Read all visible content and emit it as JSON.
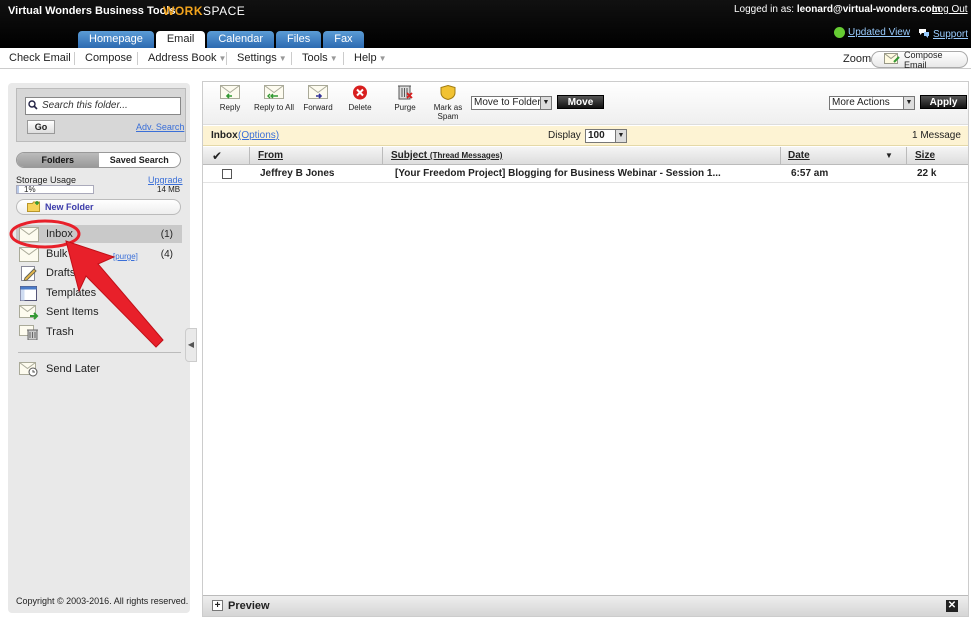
{
  "app": {
    "brand": "Virtual Wonders Business Tools",
    "workspace_logo": {
      "part1": "WORK",
      "part2": "SPACE"
    },
    "logged_in_prefix": "Logged in as:",
    "logged_in_user": "leonard@virtual-wonders.com",
    "logout": "Log Out",
    "updated_view": "Updated View",
    "support": "Support"
  },
  "tabs": [
    {
      "label": "Homepage",
      "active": false
    },
    {
      "label": "Email",
      "active": true
    },
    {
      "label": "Calendar",
      "active": false
    },
    {
      "label": "Files",
      "active": false
    },
    {
      "label": "Fax",
      "active": false
    }
  ],
  "menu": {
    "check_email": "Check Email",
    "compose": "Compose",
    "address_book": "Address Book",
    "settings": "Settings",
    "tools": "Tools",
    "help": "Help",
    "zoom": "Zoom",
    "compose_email": "Compose Email"
  },
  "sidebar": {
    "search_placeholder": "Search this folder...",
    "go": "Go",
    "adv_search": "Adv. Search",
    "tab_folders": "Folders",
    "tab_saved_search": "Saved Search",
    "storage_label": "Storage Usage",
    "upgrade": "Upgrade",
    "storage_percent": "1%",
    "storage_used_fraction": 0.01,
    "storage_size": "14 MB",
    "new_folder": "New Folder",
    "folders": [
      {
        "name": "Inbox",
        "count": "(1)",
        "icon": "envelope-icon"
      },
      {
        "name": "Bulk Mail",
        "count": "(4)",
        "icon": "envelope-icon",
        "purge": "[purge]"
      },
      {
        "name": "Drafts",
        "count": "",
        "icon": "pencil-icon"
      },
      {
        "name": "Templates",
        "count": "",
        "icon": "template-icon"
      },
      {
        "name": "Sent Items",
        "count": "",
        "icon": "envelope-arrow-icon"
      },
      {
        "name": "Trash",
        "count": "",
        "icon": "trash-icon"
      }
    ],
    "send_later": "Send Later",
    "copyright": "Copyright © 2003-2016. All rights reserved."
  },
  "toolbar": {
    "reply": "Reply",
    "reply_all": "Reply to All",
    "forward": "Forward",
    "delete": "Delete",
    "purge": "Purge",
    "mark_spam_line1": "Mark as",
    "mark_spam_line2": "Spam",
    "move_to_folder": "Move to Folder",
    "move": "Move",
    "more_actions": "More Actions",
    "apply": "Apply"
  },
  "infobar": {
    "folder": "Inbox",
    "options": "(Options)",
    "display_label": "Display",
    "display_value": "100",
    "message_count": "1 Message"
  },
  "columns": {
    "from": "From",
    "subject": "Subject",
    "thread_messages": "(Thread Messages)",
    "date": "Date",
    "size": "Size"
  },
  "messages": [
    {
      "from": "Jeffrey B Jones",
      "subject": "[Your Freedom Project] Blogging for Business Webinar - Session 1...",
      "date": "6:57 am",
      "size": "22 k"
    }
  ],
  "preview": "Preview",
  "colors": {
    "accent_tab": "#2c6ab1",
    "workspace_orange": "#f3a41d",
    "annotation_red": "#e8202a",
    "infobar": "#fdf3d3"
  }
}
